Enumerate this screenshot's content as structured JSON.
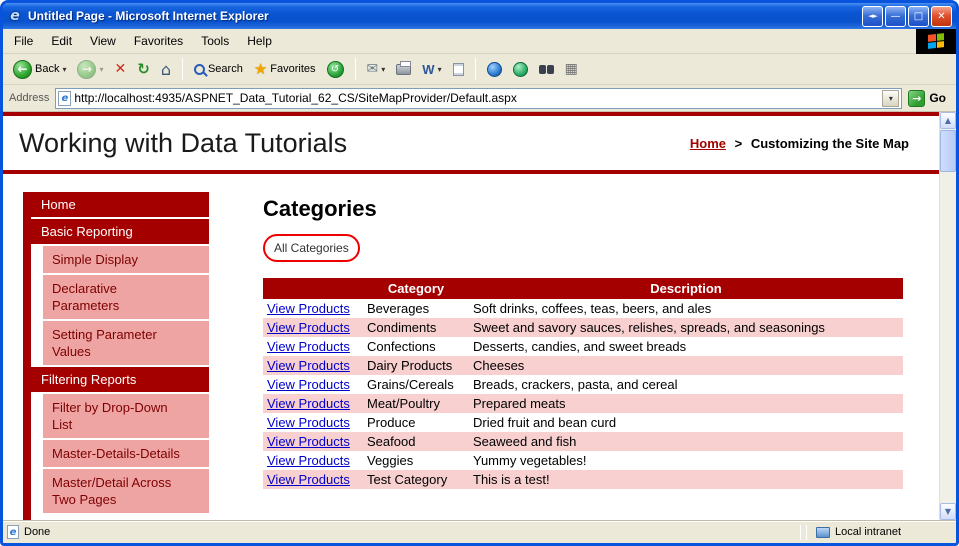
{
  "window": {
    "title": "Untitled Page - Microsoft Internet Explorer"
  },
  "icons": {
    "ie_logo": "e",
    "window_arrows": "◄►",
    "minimize": "—",
    "maximize": "□",
    "close": "✕",
    "back": "←",
    "forward": "→",
    "stop": "✕",
    "refresh": "↻",
    "home": "⌂",
    "star": "★",
    "history": "↺",
    "mail": "✉",
    "word": "W",
    "dropdown": "▾",
    "go": "→",
    "grid": "▦",
    "scroll_up": "▲",
    "scroll_down": "▼"
  },
  "menubar": {
    "items": [
      "File",
      "Edit",
      "View",
      "Favorites",
      "Tools",
      "Help"
    ]
  },
  "toolbar": {
    "back": "Back",
    "search": "Search",
    "favorites": "Favorites"
  },
  "addressbar": {
    "label": "Address",
    "url": "http://localhost:4935/ASPNET_Data_Tutorial_62_CS/SiteMapProvider/Default.aspx",
    "go": "Go"
  },
  "header": {
    "title": "Working with Data Tutorials",
    "home": "Home",
    "separator": ">",
    "current": "Customizing the Site Map"
  },
  "sidebar": {
    "items": [
      "Home",
      "Basic Reporting",
      "Simple Display",
      "Declarative Parameters",
      "Setting Parameter Values",
      "Filtering Reports",
      "Filter by Drop-Down List",
      "Master-Details-Details",
      "Master/Detail Across Two Pages"
    ]
  },
  "main": {
    "title": "Categories",
    "all_categories": "All Categories",
    "table": {
      "col_category": "Category",
      "col_description": "Description",
      "link": "View Products",
      "rows": [
        {
          "category": "Beverages",
          "description": "Soft drinks, coffees, teas, beers, and ales"
        },
        {
          "category": "Condiments",
          "description": "Sweet and savory sauces, relishes, spreads, and seasonings"
        },
        {
          "category": "Confections",
          "description": "Desserts, candies, and sweet breads"
        },
        {
          "category": "Dairy Products",
          "description": "Cheeses"
        },
        {
          "category": "Grains/Cereals",
          "description": "Breads, crackers, pasta, and cereal"
        },
        {
          "category": "Meat/Poultry",
          "description": "Prepared meats"
        },
        {
          "category": "Produce",
          "description": "Dried fruit and bean curd"
        },
        {
          "category": "Seafood",
          "description": "Seaweed and fish"
        },
        {
          "category": "Veggies",
          "description": "Yummy vegetables!"
        },
        {
          "category": "Test Category",
          "description": "This is a test!"
        }
      ]
    }
  },
  "statusbar": {
    "done": "Done",
    "zone": "Local intranet"
  },
  "colors": {
    "maroon": "#a40000",
    "sidebar_pink": "#efa4a4",
    "sidebar_text": "#7d0000",
    "row_pink": "#f8d0d0",
    "link_blue": "#0000cc",
    "annotation_red": "#ee0000"
  }
}
